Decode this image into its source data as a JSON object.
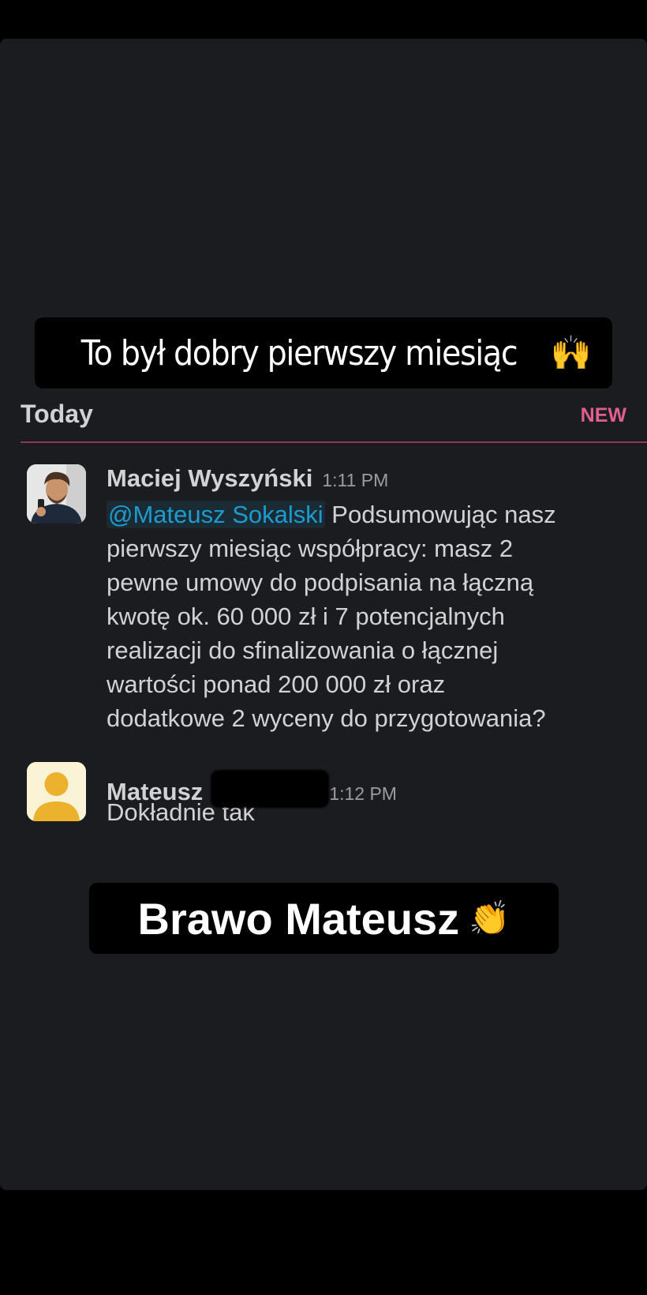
{
  "captions": {
    "top": "To był dobry pierwszy miesiąc",
    "top_emoji": "🙌",
    "bottom": "Brawo Mateusz",
    "bottom_emoji": "👏"
  },
  "divider": {
    "today_label": "Today",
    "new_label": "NEW"
  },
  "messages": [
    {
      "sender": "Maciej Wyszyński",
      "time": "1:11 PM",
      "mention": "@Mateusz Sokalski",
      "text": " Podsumowując nasz\npierwszy miesiąc współpracy: masz 2\npewne umowy do podpisania na łączną\nkwotę ok. 60 000 zł i 7 potencjalnych\nrealizacji do sfinalizowania o łącznej\nwartości ponad  200 000 zł oraz\ndodatkowe 2 wyceny do przygotowania?",
      "avatar": "profile-photo"
    },
    {
      "sender": "Mateusz",
      "time": "1:12 PM",
      "text": "Dokładnie tak",
      "avatar": "default-user-icon"
    }
  ],
  "colors": {
    "background": "#1b1c1f",
    "text": "#d1d2d3",
    "mention": "#1d9bd1",
    "new_badge": "#e0608d",
    "divider": "#8a3a54"
  }
}
